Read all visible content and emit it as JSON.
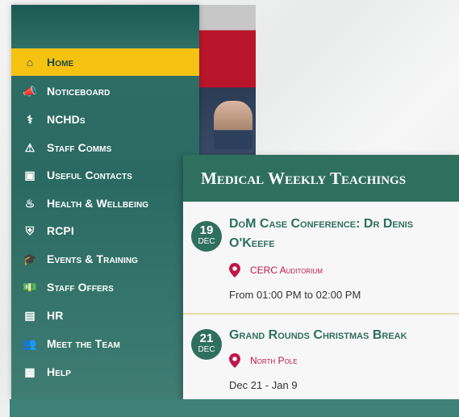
{
  "nav": {
    "items": [
      {
        "label": "Home",
        "icon": "home-icon",
        "glyph": "⌂",
        "active": true
      },
      {
        "label": "Noticeboard",
        "icon": "megaphone-icon",
        "glyph": "📣"
      },
      {
        "label": "NCHDs",
        "icon": "caduceus-icon",
        "glyph": "⚕"
      },
      {
        "label": "Staff Comms",
        "icon": "broadcast-icon",
        "glyph": "⚠"
      },
      {
        "label": "Useful Contacts",
        "icon": "contacts-icon",
        "glyph": "▣"
      },
      {
        "label": "Health & Wellbeing",
        "icon": "wellbeing-icon",
        "glyph": "♨"
      },
      {
        "label": "RCPI",
        "icon": "shield-icon",
        "glyph": "⛨"
      },
      {
        "label": "Events & Training",
        "icon": "graduation-cap-icon",
        "glyph": "🎓"
      },
      {
        "label": "Staff Offers",
        "icon": "cash-icon",
        "glyph": "💵"
      },
      {
        "label": "HR",
        "icon": "id-card-icon",
        "glyph": "▤"
      },
      {
        "label": "Meet the Team",
        "icon": "team-icon",
        "glyph": "👥"
      },
      {
        "label": "Help",
        "icon": "help-grid-icon",
        "glyph": "▦"
      }
    ]
  },
  "card": {
    "title": "Medical Weekly Teachings",
    "events": [
      {
        "day": "19",
        "month": "DEC",
        "title": "DoM Case Conference: Dr Denis O'Keefe",
        "location": "CERC Auditorium",
        "time": "From 01:00 PM to 02:00 PM"
      },
      {
        "day": "21",
        "month": "DEC",
        "title": "Grand Rounds Christmas Break",
        "location": "North Pole",
        "time": "Dec 21 - Jan 9"
      }
    ]
  },
  "colors": {
    "accent": "#f6c212",
    "brand": "#2f6f5e",
    "location": "#c0174a"
  }
}
